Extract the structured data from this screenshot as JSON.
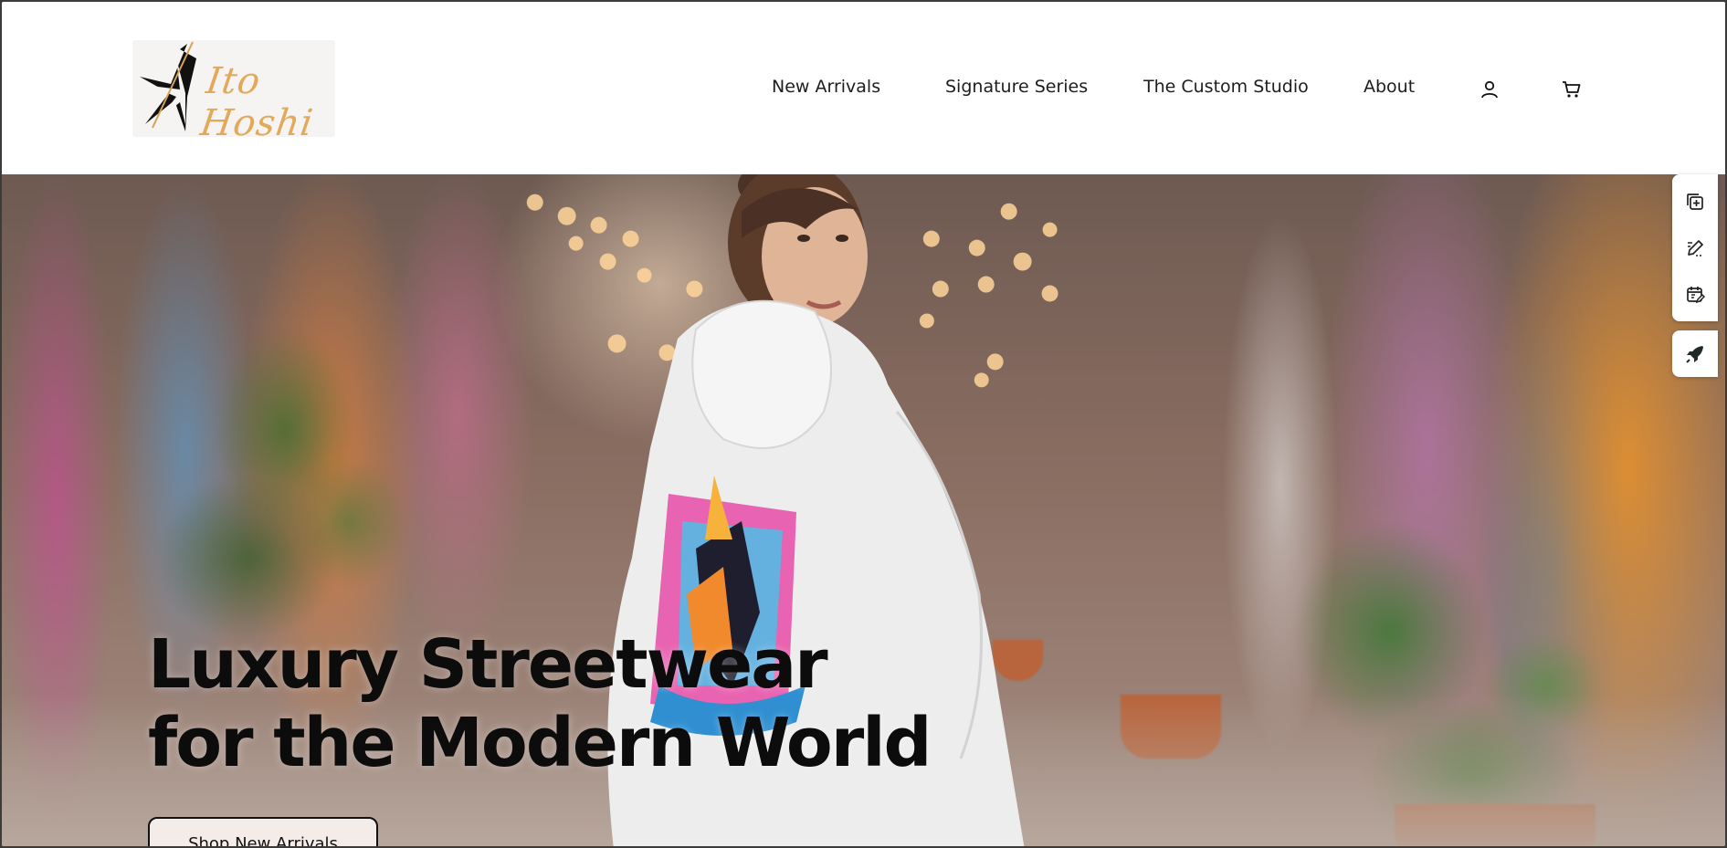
{
  "brand": {
    "logo_text": "Ito Hoshi"
  },
  "nav": {
    "items": [
      {
        "label": "New Arrivals"
      },
      {
        "label": "Signature Series"
      },
      {
        "label": "The Custom Studio"
      },
      {
        "label": "About"
      }
    ],
    "account_icon": "user-icon",
    "cart_icon": "cart-icon"
  },
  "hero": {
    "headline_line1": "Luxury Streetwear",
    "headline_line2": "for the Modern World",
    "cta_label": "Shop New Arrivals"
  },
  "side_tools": {
    "icons": [
      "copy-add-icon",
      "edit-pen-icon",
      "calendar-edit-icon",
      "rocket-icon"
    ]
  },
  "colors": {
    "logo_accent": "#e3a95a",
    "text": "#1d1d1d",
    "header_bg": "#ffffff"
  }
}
